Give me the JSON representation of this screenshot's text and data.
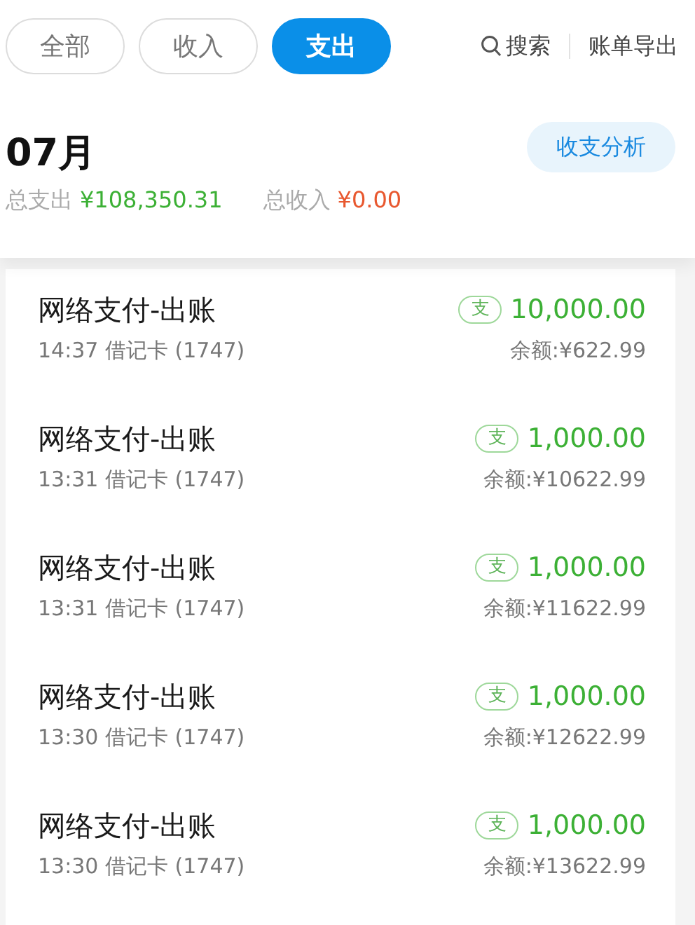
{
  "tabs": [
    {
      "label": "全部",
      "selected": false
    },
    {
      "label": "收入",
      "selected": false
    },
    {
      "label": "支出",
      "selected": true
    }
  ],
  "actions": {
    "search": "搜索",
    "export": "账单导出"
  },
  "month": {
    "title": "07月",
    "expense_label": "总支出",
    "expense": "¥108,350.31",
    "income_label": "总收入",
    "income": "¥0.00",
    "analysis_button": "收支分析"
  },
  "transactions": [
    {
      "title": "网络支付-出账",
      "detail": "14:37 借记卡 (1747)",
      "badge": "支",
      "amount": "10,000.00",
      "balance": "余额:¥622.99"
    },
    {
      "title": "网络支付-出账",
      "detail": "13:31 借记卡 (1747)",
      "badge": "支",
      "amount": "1,000.00",
      "balance": "余额:¥10622.99"
    },
    {
      "title": "网络支付-出账",
      "detail": "13:31 借记卡 (1747)",
      "badge": "支",
      "amount": "1,000.00",
      "balance": "余额:¥11622.99"
    },
    {
      "title": "网络支付-出账",
      "detail": "13:30 借记卡 (1747)",
      "badge": "支",
      "amount": "1,000.00",
      "balance": "余额:¥12622.99"
    },
    {
      "title": "网络支付-出账",
      "detail": "13:30 借记卡 (1747)",
      "badge": "支",
      "amount": "1,000.00",
      "balance": "余额:¥13622.99"
    }
  ]
}
